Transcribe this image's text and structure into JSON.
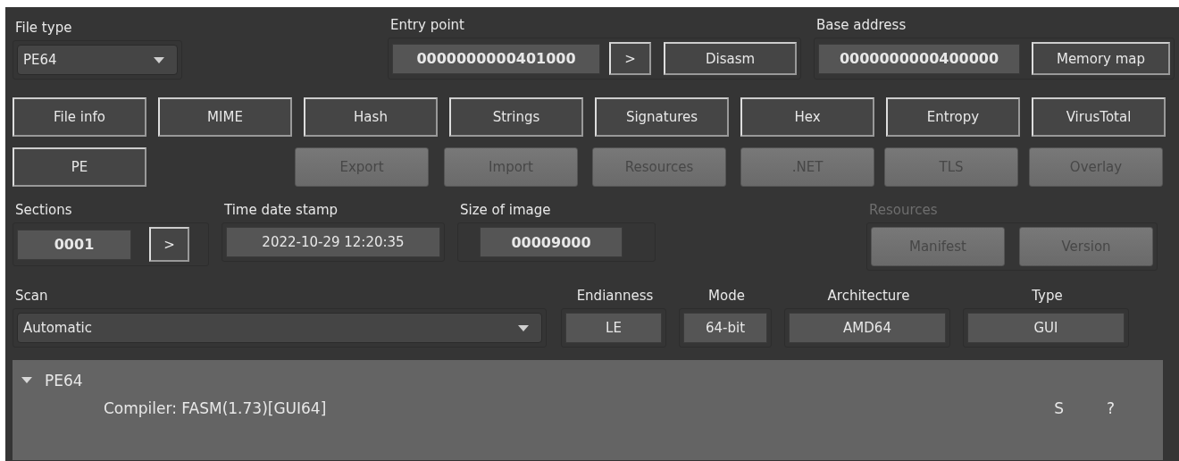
{
  "file_type": {
    "label": "File type",
    "value": "PE64"
  },
  "entry_point": {
    "label": "Entry point",
    "value": "0000000000401000",
    "buttons": [
      ">",
      "Disasm"
    ]
  },
  "base_address": {
    "label": "Base address",
    "value": "0000000000400000",
    "button": "Memory map"
  },
  "tool_rows": [
    [
      {
        "label": "File info",
        "disabled": false
      },
      {
        "label": "MIME",
        "disabled": false
      },
      {
        "label": "Hash",
        "disabled": false
      },
      {
        "label": "Strings",
        "disabled": false
      },
      {
        "label": "Signatures",
        "disabled": false
      },
      {
        "label": "Hex",
        "disabled": false
      },
      {
        "label": "Entropy",
        "disabled": false
      },
      {
        "label": "VirusTotal",
        "disabled": false
      }
    ],
    [
      {
        "label": "PE",
        "disabled": false
      },
      {
        "label": "Export",
        "disabled": true
      },
      {
        "label": "Import",
        "disabled": true
      },
      {
        "label": "Resources",
        "disabled": true
      },
      {
        "label": ".NET",
        "disabled": true
      },
      {
        "label": "TLS",
        "disabled": true
      },
      {
        "label": "Overlay",
        "disabled": true
      }
    ]
  ],
  "sections": {
    "label": "Sections",
    "value": "0001",
    "button": ">"
  },
  "time_date_stamp": {
    "label": "Time date stamp",
    "value": "2022-10-29 12:20:35"
  },
  "size_of_image": {
    "label": "Size of image",
    "value": "00009000"
  },
  "resources": {
    "label": "Resources",
    "disabled": true,
    "buttons": [
      {
        "label": "Manifest",
        "disabled": true
      },
      {
        "label": "Version",
        "disabled": true
      }
    ]
  },
  "scan": {
    "label": "Scan",
    "value": "Automatic"
  },
  "info": [
    {
      "label": "Endianness",
      "value": "LE"
    },
    {
      "label": "Mode",
      "value": "64-bit"
    },
    {
      "label": "Architecture",
      "value": "AMD64"
    },
    {
      "label": "Type",
      "value": "GUI"
    }
  ],
  "results": [
    {
      "label": "PE64",
      "expanded": true,
      "children": [
        {
          "text": "Compiler: FASM(1.73)[GUI64]",
          "buttons": [
            "S",
            "?"
          ]
        }
      ]
    }
  ]
}
